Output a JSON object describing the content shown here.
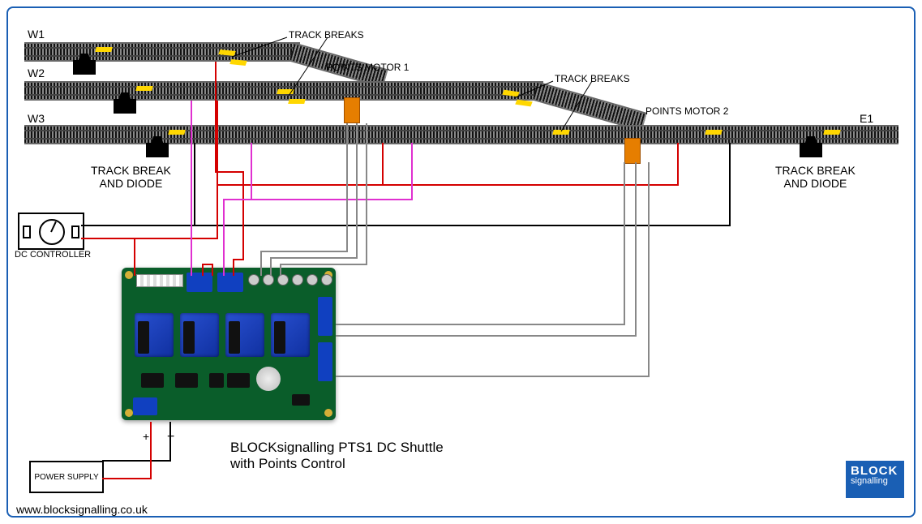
{
  "labels": {
    "w1": "W1",
    "w2": "W2",
    "w3": "W3",
    "e1": "E1",
    "track_breaks_1": "TRACK BREAKS",
    "track_breaks_2": "TRACK BREAKS",
    "points_motor_1": "POINTS MOTOR 1",
    "points_motor_2": "POINTS MOTOR 2",
    "track_break_diode_left_l1": "TRACK BREAK",
    "track_break_diode_left_l2": "AND DIODE",
    "track_break_diode_right_l1": "TRACK BREAK",
    "track_break_diode_right_l2": "AND DIODE",
    "dc_controller": "DC CONTROLLER",
    "power_supply": "POWER SUPPLY",
    "plus": "+",
    "minus": "−",
    "product_l1": "BLOCKsignalling PTS1 DC Shuttle",
    "product_l2": "with Points Control",
    "url": "www.blocksignalling.co.uk",
    "logo_l1": "BLOCK",
    "logo_l2": "signalling"
  },
  "wire_colors": {
    "black": "#000000",
    "red": "#d40000",
    "grey": "#888888",
    "magenta": "#e030d0"
  }
}
